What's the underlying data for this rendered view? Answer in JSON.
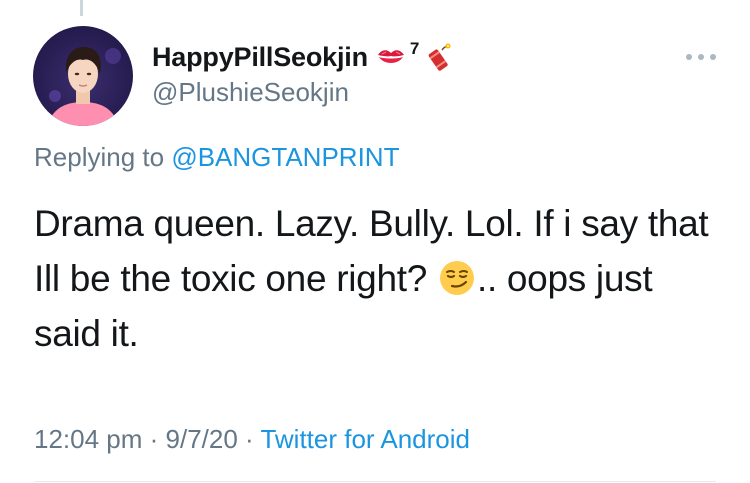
{
  "tweet": {
    "display_name": "HappyPillSeokjin",
    "name_superscript": "7",
    "handle": "@PlushieSeokjin",
    "name_emojis": [
      "kiss-mark",
      "firecracker"
    ],
    "replying_prefix": "Replying to ",
    "replying_to": "@BANGTANPRINT",
    "body_part1": "Drama queen. Lazy. Bully. Lol. If i say that Ill be the toxic one right? ",
    "body_part2": ".. oops just said it.",
    "body_emoji": "smirking-face",
    "time": "12:04 pm",
    "sep1": " · ",
    "date": "9/7/20",
    "sep2": " · ",
    "source": "Twitter for Android"
  },
  "colors": {
    "text": "#14171a",
    "secondary": "#657786",
    "link": "#1b95e0",
    "divider": "#e6ecf0"
  }
}
